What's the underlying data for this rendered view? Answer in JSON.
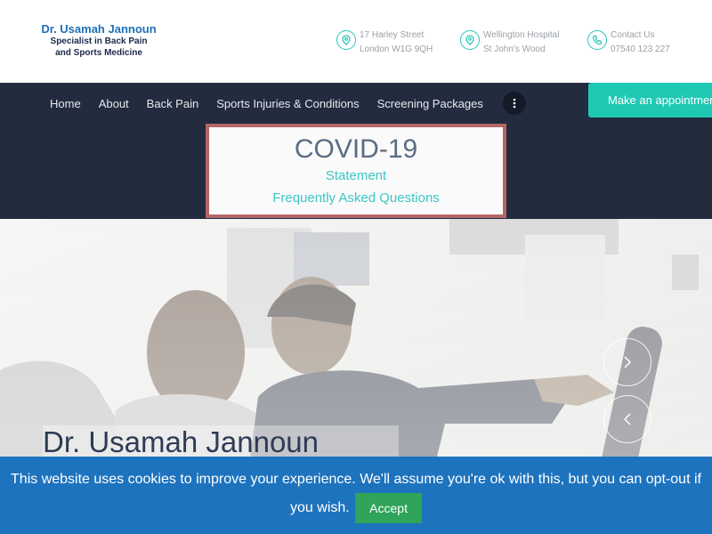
{
  "logo": {
    "name": "Dr. Usamah Jannoun",
    "tagline_line1": "Specialist in Back Pain",
    "tagline_line2": "and Sports Medicine"
  },
  "contacts": [
    {
      "icon": "location-pin-icon",
      "line1": "17 Harley Street",
      "line2": "London W1G 9QH"
    },
    {
      "icon": "location-pin-icon",
      "line1": "Wellington Hospital",
      "line2": "St John's Wood"
    },
    {
      "icon": "phone-icon",
      "line1": "Contact Us",
      "line2": "07540 123 227"
    }
  ],
  "nav": {
    "items": [
      "Home",
      "About",
      "Back Pain",
      "Sports Injuries & Conditions",
      "Screening Packages"
    ],
    "more_icon": "more-vertical-icon",
    "appointment_label": "Make an appointment"
  },
  "covid": {
    "title": "COVID-19",
    "link1": "Statement",
    "link2": "Frequently Asked Questions"
  },
  "hero": {
    "title": "Dr. Usamah Jannoun"
  },
  "cookie": {
    "message": "This website uses cookies to improve your experience. We'll assume you're ok with this, but you can opt-out if you wish.",
    "accept_label": "Accept"
  },
  "colors": {
    "accent": "#1fc9b4",
    "nav_bg": "#232b3e",
    "cookie_bg": "#1e73be",
    "accept_bg": "#2fa45a",
    "covid_border": "#b56666",
    "logo_blue": "#1d6fb8"
  }
}
